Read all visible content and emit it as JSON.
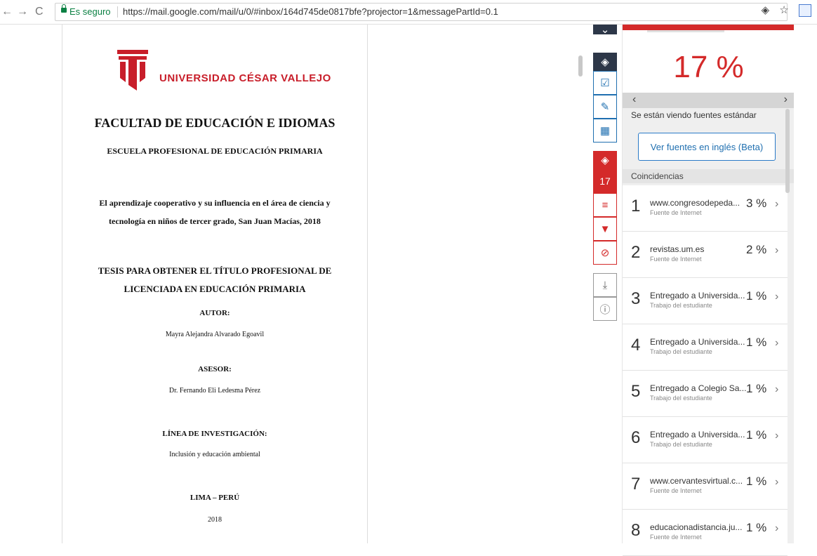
{
  "browser": {
    "back": "←",
    "forward": "→",
    "reload": "C",
    "secure_label": "Es seguro",
    "url": "https://mail.google.com/mail/u/0/#inbox/164d745de0817bfe?projector=1&messagePartId=0.1"
  },
  "document": {
    "university": "UNIVERSIDAD CÉSAR VALLEJO",
    "faculty": "FACULTAD DE EDUCACIÓN E IDIOMAS",
    "school": "ESCUELA PROFESIONAL DE EDUCACIÓN PRIMARIA",
    "thesis_line1": "El aprendizaje cooperativo y su influencia en el área de ciencia y",
    "thesis_line2": "tecnología en niños de tercer grado, San Juan Macías, 2018",
    "degree_line1": "TESIS PARA OBTENER EL TÍTULO PROFESIONAL DE",
    "degree_line2": "LICENCIADA EN EDUCACIÓN PRIMARIA",
    "author_label": "AUTOR:",
    "author": "Mayra Alejandra Alvarado Egoavil",
    "advisor_label": "ASESOR:",
    "advisor": "Dr. Fernando Eli Ledesma Pérez",
    "research_label": "LÍNEA DE INVESTIGACIÓN:",
    "research": "Inclusión y educación ambiental",
    "place": "LIMA – PERÚ",
    "year": "2018"
  },
  "toolbar": {
    "score": "17"
  },
  "panel": {
    "percent": "17 %",
    "standard_sources": "Se están viendo fuentes estándar",
    "english_button": "Ver fuentes en inglés (Beta)",
    "matches_header": "Coincidencias",
    "matches": [
      {
        "n": "1",
        "name": "www.congresodepeda...",
        "type": "Fuente de Internet",
        "pct": "3 %"
      },
      {
        "n": "2",
        "name": "revistas.um.es",
        "type": "Fuente de Internet",
        "pct": "2 %"
      },
      {
        "n": "3",
        "name": "Entregado a Universida...",
        "type": "Trabajo del estudiante",
        "pct": "1 %"
      },
      {
        "n": "4",
        "name": "Entregado a Universida...",
        "type": "Trabajo del estudiante",
        "pct": "1 %"
      },
      {
        "n": "5",
        "name": "Entregado a Colegio Sa...",
        "type": "Trabajo del estudiante",
        "pct": "1 %"
      },
      {
        "n": "6",
        "name": "Entregado a Universida...",
        "type": "Trabajo del estudiante",
        "pct": "1 %"
      },
      {
        "n": "7",
        "name": "www.cervantesvirtual.c...",
        "type": "Fuente de Internet",
        "pct": "1 %"
      },
      {
        "n": "8",
        "name": "educacionadistancia.ju...",
        "type": "Fuente de Internet",
        "pct": "1 %"
      }
    ]
  }
}
